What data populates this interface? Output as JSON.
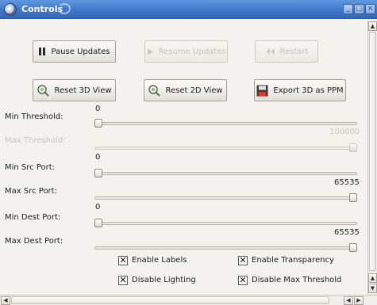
{
  "window": {
    "title": "Controls"
  },
  "toolbar": {
    "pause_label": "Pause Updates",
    "resume_label": "Resume Updates",
    "restart_label": "Restart",
    "reset3d_label": "Reset 3D View",
    "reset2d_label": "Reset 2D View",
    "export_label": "Export 3D as PPM"
  },
  "sliders": [
    {
      "label": "Min Threshold:",
      "value_text": "0",
      "value": 0,
      "max": 100000,
      "enabled": true
    },
    {
      "label": "Max Threshold:",
      "value_text": "100000",
      "value": 100000,
      "max": 100000,
      "enabled": false
    },
    {
      "label": "Min Src Port:",
      "value_text": "0",
      "value": 0,
      "max": 65535,
      "enabled": true
    },
    {
      "label": "Max Src Port:",
      "value_text": "65535",
      "value": 65535,
      "max": 65535,
      "enabled": true
    },
    {
      "label": "Min Dest Port:",
      "value_text": "0",
      "value": 0,
      "max": 65535,
      "enabled": true
    },
    {
      "label": "Max Dest Port:",
      "value_text": "65535",
      "value": 65535,
      "max": 65535,
      "enabled": true
    }
  ],
  "checkboxes": {
    "enable_labels": {
      "label": "Enable Labels",
      "checked": true
    },
    "enable_transparency": {
      "label": "Enable Transparency",
      "checked": true
    },
    "disable_lighting": {
      "label": "Disable Lighting",
      "checked": true
    },
    "disable_max_threshold": {
      "label": "Disable Max Threshold",
      "checked": true
    }
  },
  "icons": {
    "pause": "pause-icon",
    "resume": "play-icon",
    "restart": "rewind-icon",
    "reset3d": "magnifier-icon",
    "reset2d": "magnifier-icon",
    "export": "floppy-disk-icon"
  }
}
